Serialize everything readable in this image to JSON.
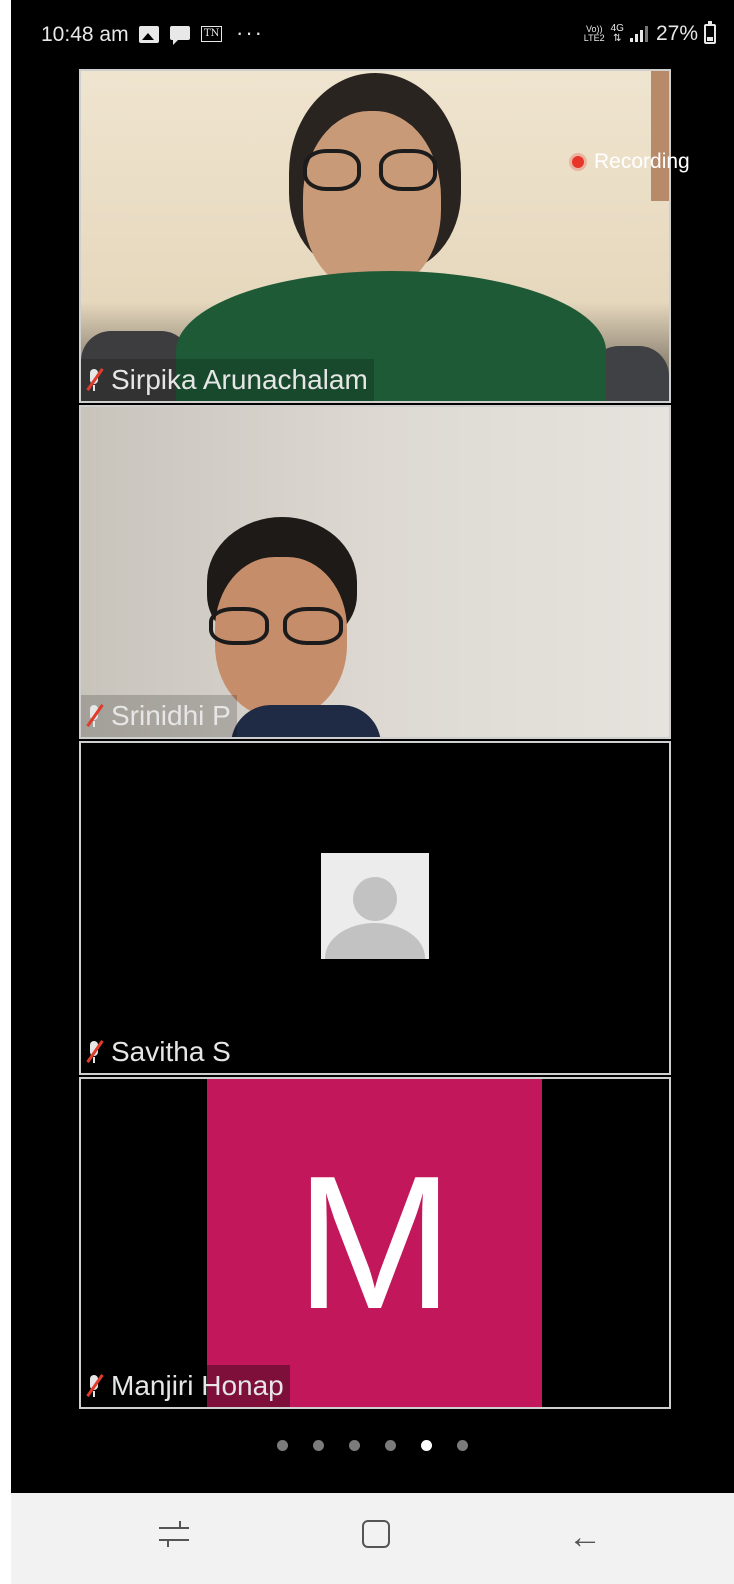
{
  "status_bar": {
    "time": "10:48 am",
    "more": "···",
    "tn_label": "TN",
    "volte_line1": "Vo))",
    "volte_line2": "LTE2",
    "network": "4G",
    "battery": "27%",
    "battery_level": 0.27,
    "icons": [
      "gallery-icon",
      "chat-icon",
      "tn-icon",
      "more-icon",
      "volte-icon",
      "network-4g-icon",
      "signal-icon",
      "battery-icon"
    ]
  },
  "recording": {
    "label": "Recording",
    "color": "#e8352a"
  },
  "participants": [
    {
      "name": "Sirpika Arunachalam",
      "muted": true,
      "type": "video"
    },
    {
      "name": "Srinidhi P",
      "muted": true,
      "type": "video"
    },
    {
      "name": "Savitha S",
      "muted": true,
      "type": "no-video-avatar"
    },
    {
      "name": "Manjiri Honap",
      "muted": true,
      "type": "initial",
      "initial": "M",
      "color": "#c2185b"
    }
  ],
  "pagination": {
    "total": 6,
    "active_index": 4
  },
  "nav_bar": {
    "buttons": [
      "recents-icon",
      "home-icon",
      "back-icon"
    ],
    "back_glyph": "←"
  }
}
